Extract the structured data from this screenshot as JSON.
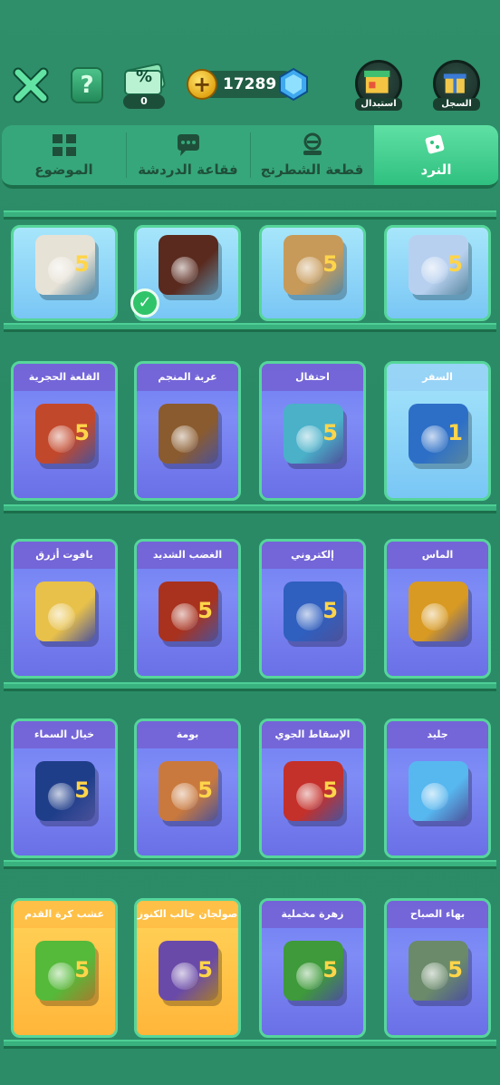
{
  "header": {
    "coins": "17289",
    "ticket_count": "0",
    "ticket_label": "%",
    "help_label": "?",
    "coin_symbol": "+",
    "exchange_label": "استبدال",
    "history_label": "السجل"
  },
  "tabs": [
    {
      "label": "الموضوع",
      "icon": "theme-grid-icon"
    },
    {
      "label": "فقاعة الدردشة",
      "icon": "chat-bubble-icon"
    },
    {
      "label": "قطعة الشطرنج",
      "icon": "chess-piece-icon"
    },
    {
      "label": "النرد",
      "icon": "dice-icon",
      "active": true
    }
  ],
  "row0": [
    {
      "title": "",
      "style": "blue",
      "num": "5",
      "face": "#e7e2d6",
      "emb": "rainbow-icon"
    },
    {
      "title": "",
      "style": "blue",
      "num": "",
      "face": "#5a2a1e",
      "emb": "swirl-icon"
    },
    {
      "title": "",
      "style": "blue",
      "num": "5",
      "face": "#c79a5a",
      "emb": "crown-icon"
    },
    {
      "title": "",
      "style": "blue",
      "num": "5",
      "face": "#b8d0ef",
      "emb": "question-icon"
    }
  ],
  "row1": [
    {
      "title": "القلعة الحجرية",
      "style": "purple",
      "num": "5",
      "face": "#c2482b",
      "emb": "door-icon"
    },
    {
      "title": "عربة المنجم",
      "style": "purple",
      "num": "",
      "face": "#8a5b2e",
      "emb": "mine-cart-icon"
    },
    {
      "title": "احتفال",
      "style": "purple",
      "num": "5",
      "face": "#4ab1c9",
      "emb": "mask-icon"
    },
    {
      "title": "السفر",
      "style": "blue",
      "num": "1",
      "face": "#2d6fc7",
      "emb": "bus-icon"
    }
  ],
  "row2": [
    {
      "title": "يافوت أزرق",
      "style": "purple",
      "num": "",
      "face": "#e8c14a",
      "emb": "star-icon"
    },
    {
      "title": "الغضب الشديد",
      "style": "purple",
      "num": "5",
      "face": "#a8321e",
      "emb": "lava-icon"
    },
    {
      "title": "إلكتروني",
      "style": "purple",
      "num": "5",
      "face": "#2f5fbf",
      "emb": "crown-icon"
    },
    {
      "title": "الماس",
      "style": "purple",
      "num": "",
      "face": "#d89a22",
      "emb": "diamond-icon"
    }
  ],
  "row3": [
    {
      "title": "خيال السماء",
      "style": "purple",
      "num": "5",
      "face": "#1f3e8a",
      "emb": "sky-icon"
    },
    {
      "title": "بومة",
      "style": "purple",
      "num": "5",
      "face": "#c9793d",
      "emb": "owl-icon"
    },
    {
      "title": "الإسقاط الجوي",
      "style": "purple",
      "num": "5",
      "face": "#c4302a",
      "emb": "crate-icon"
    },
    {
      "title": "جليد",
      "style": "purple",
      "num": "",
      "face": "#57b7ef",
      "emb": "ice-star-icon"
    }
  ],
  "row4": [
    {
      "title": "عشب كرة القدم",
      "style": "gold",
      "num": "5",
      "face": "#55b93a",
      "emb": "soccer-ball-icon"
    },
    {
      "title": "صولجان جالب الكنوز",
      "style": "gold",
      "num": "5",
      "face": "#6a4aa8",
      "emb": "scepter-icon"
    },
    {
      "title": "زهرة مخملية",
      "style": "purple",
      "num": "5",
      "face": "#3e9a3a",
      "emb": "flower-icon"
    },
    {
      "title": "بهاء الصباح",
      "style": "purple",
      "num": "5",
      "face": "#6a8a6a",
      "emb": "morning-glory-icon"
    }
  ]
}
